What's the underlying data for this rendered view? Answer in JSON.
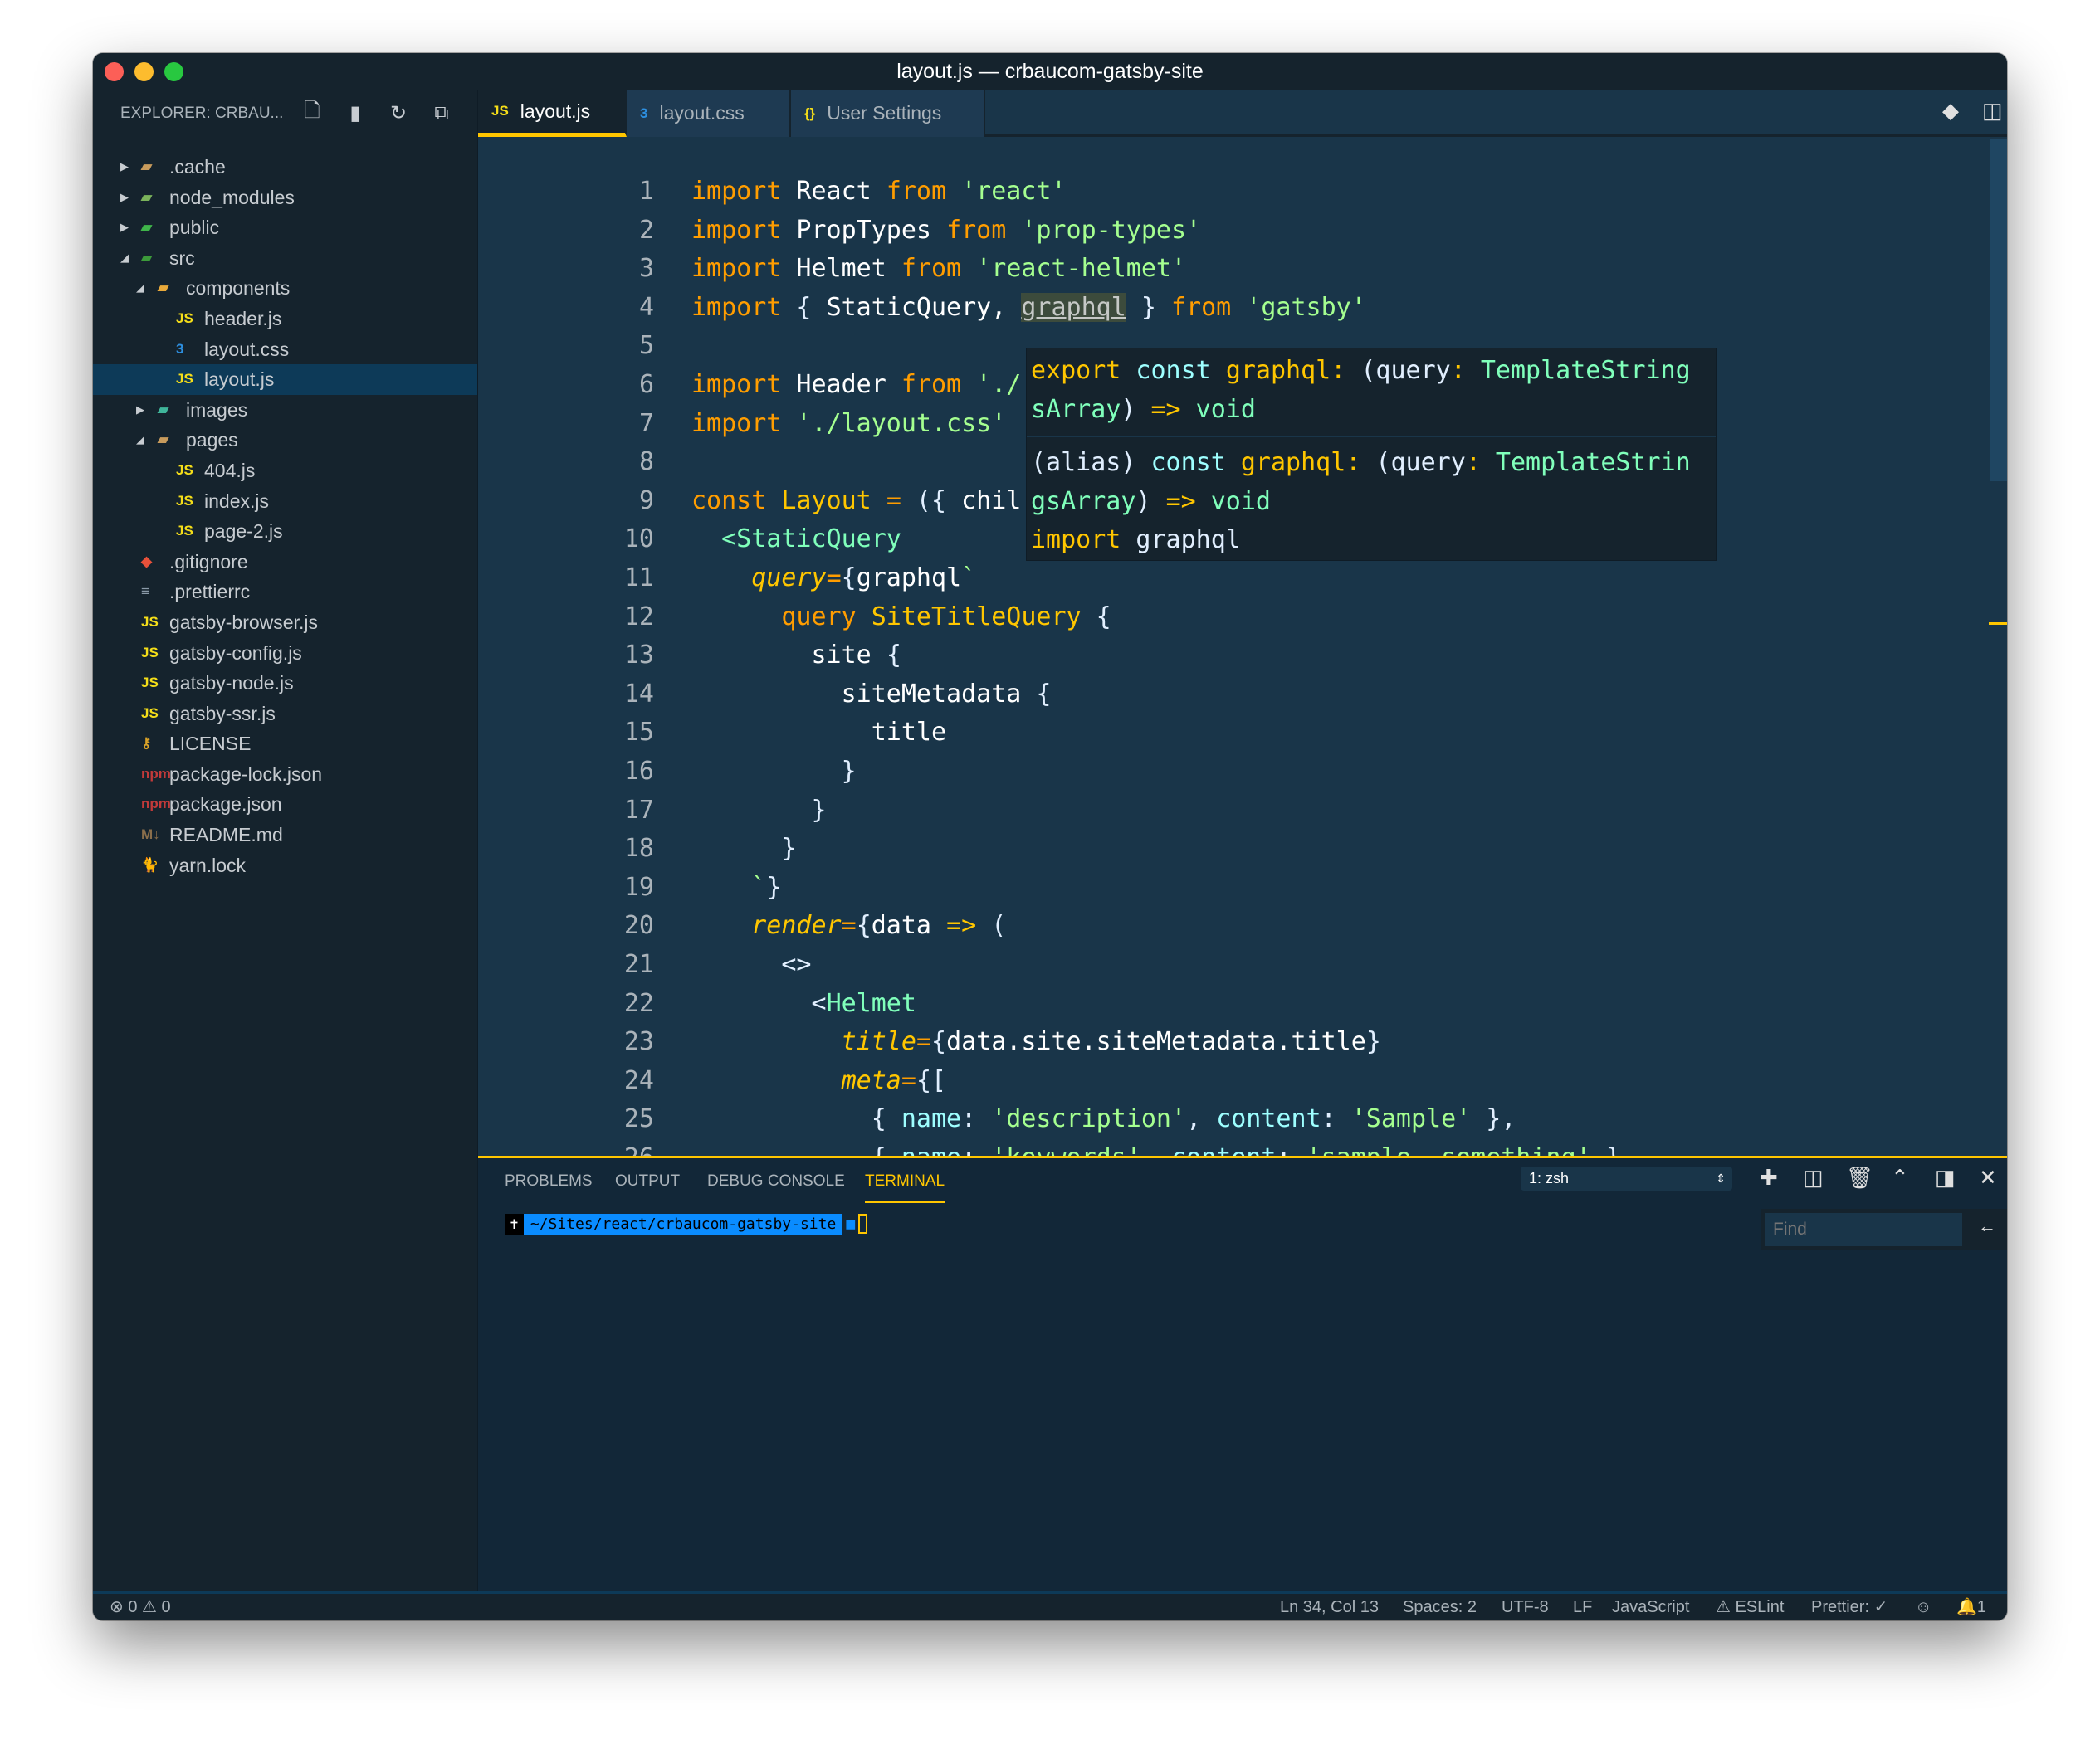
{
  "window": {
    "title": "layout.js — crbaucom-gatsby-site"
  },
  "colors": {
    "accent": "#ffc600",
    "editor_bg": "#193549",
    "sidebar_bg": "#15232d",
    "keyword": "#ff9d00",
    "string": "#a5ff90"
  },
  "sidebar": {
    "title": "EXPLORER: CRBAU...",
    "actions": [
      "new-file-icon",
      "new-folder-icon",
      "refresh-icon",
      "collapse-all-icon"
    ],
    "items": [
      {
        "label": ".cache",
        "level": 0,
        "kind": "folder",
        "expanded": false,
        "icon": "folder-icon",
        "icon_text": "▰",
        "color": "#c89b5c"
      },
      {
        "label": "node_modules",
        "level": 0,
        "kind": "folder",
        "expanded": false,
        "icon": "node-folder-icon",
        "icon_text": "▰",
        "color": "#7bb35b"
      },
      {
        "label": "public",
        "level": 0,
        "kind": "folder",
        "expanded": false,
        "icon": "public-folder-icon",
        "icon_text": "▰",
        "color": "#3fb54a"
      },
      {
        "label": "src",
        "level": 0,
        "kind": "folder",
        "expanded": true,
        "icon": "src-folder-icon",
        "icon_text": "▰",
        "color": "#3c9a3a"
      },
      {
        "label": "components",
        "level": 1,
        "kind": "folder",
        "expanded": true,
        "icon": "components-folder-icon",
        "icon_text": "▰",
        "color": "#e8a93a"
      },
      {
        "label": "header.js",
        "level": 2,
        "kind": "file",
        "icon": "javascript-file-icon",
        "icon_text": "JS",
        "color": "#f5de19"
      },
      {
        "label": "layout.css",
        "level": 2,
        "kind": "file",
        "icon": "css-file-icon",
        "icon_text": "3",
        "color": "#2d8fe0"
      },
      {
        "label": "layout.js",
        "level": 2,
        "kind": "file",
        "icon": "javascript-file-icon",
        "icon_text": "JS",
        "color": "#f5de19",
        "selected": true
      },
      {
        "label": "images",
        "level": 1,
        "kind": "folder",
        "expanded": false,
        "icon": "images-folder-icon",
        "icon_text": "▰",
        "color": "#3fb59a"
      },
      {
        "label": "pages",
        "level": 1,
        "kind": "folder",
        "expanded": true,
        "icon": "folder-icon",
        "icon_text": "▰",
        "color": "#c89b5c"
      },
      {
        "label": "404.js",
        "level": 2,
        "kind": "file",
        "icon": "javascript-file-icon",
        "icon_text": "JS",
        "color": "#f5de19"
      },
      {
        "label": "index.js",
        "level": 2,
        "kind": "file",
        "icon": "javascript-file-icon",
        "icon_text": "JS",
        "color": "#f5de19"
      },
      {
        "label": "page-2.js",
        "level": 2,
        "kind": "file",
        "icon": "javascript-file-icon",
        "icon_text": "JS",
        "color": "#f5de19"
      },
      {
        "label": ".gitignore",
        "level": 0,
        "kind": "file",
        "icon": "git-icon",
        "icon_text": "◆",
        "color": "#e8513a"
      },
      {
        "label": ".prettierrc",
        "level": 0,
        "kind": "file",
        "icon": "prettier-icon",
        "icon_text": "≡",
        "color": "#8a9aa8"
      },
      {
        "label": "gatsby-browser.js",
        "level": 0,
        "kind": "file",
        "icon": "javascript-file-icon",
        "icon_text": "JS",
        "color": "#f5de19"
      },
      {
        "label": "gatsby-config.js",
        "level": 0,
        "kind": "file",
        "icon": "javascript-file-icon",
        "icon_text": "JS",
        "color": "#f5de19"
      },
      {
        "label": "gatsby-node.js",
        "level": 0,
        "kind": "file",
        "icon": "javascript-file-icon",
        "icon_text": "JS",
        "color": "#f5de19"
      },
      {
        "label": "gatsby-ssr.js",
        "level": 0,
        "kind": "file",
        "icon": "javascript-file-icon",
        "icon_text": "JS",
        "color": "#f5de19"
      },
      {
        "label": "LICENSE",
        "level": 0,
        "kind": "file",
        "icon": "license-key-icon",
        "icon_text": "⚷",
        "color": "#d9a227"
      },
      {
        "label": "package-lock.json",
        "level": 0,
        "kind": "file",
        "icon": "npm-icon",
        "icon_text": "npm",
        "color": "#c23a3a"
      },
      {
        "label": "package.json",
        "level": 0,
        "kind": "file",
        "icon": "npm-icon",
        "icon_text": "npm",
        "color": "#c23a3a"
      },
      {
        "label": "README.md",
        "level": 0,
        "kind": "file",
        "icon": "markdown-icon",
        "icon_text": "M↓",
        "color": "#8a6e4b"
      },
      {
        "label": "yarn.lock",
        "level": 0,
        "kind": "file",
        "icon": "yarn-icon",
        "icon_text": "🐈",
        "color": "#2c8ebb"
      }
    ]
  },
  "tabs": [
    {
      "label": "layout.js",
      "icon": "javascript-file-icon",
      "icon_text": "JS",
      "color": "#f5de19",
      "active": true
    },
    {
      "label": "layout.css",
      "icon": "css-file-icon",
      "icon_text": "3",
      "color": "#2d8fe0"
    },
    {
      "label": "User Settings",
      "icon": "json-braces-icon",
      "icon_text": "{}",
      "color": "#f5de19"
    }
  ],
  "tab_actions": [
    "git-compare-icon",
    "split-editor-icon",
    "more-actions-icon"
  ],
  "editor": {
    "lines": [
      [
        [
          "kw",
          "import"
        ],
        [
          "id",
          " React "
        ],
        [
          "kw",
          "from"
        ],
        [
          "str",
          " 'react'"
        ]
      ],
      [
        [
          "kw",
          "import"
        ],
        [
          "id",
          " PropTypes "
        ],
        [
          "kw",
          "from"
        ],
        [
          "str",
          " 'prop-types'"
        ]
      ],
      [
        [
          "kw",
          "import"
        ],
        [
          "id",
          " Helmet "
        ],
        [
          "kw",
          "from"
        ],
        [
          "str",
          " 'react-helmet'"
        ]
      ],
      [
        [
          "kw",
          "import"
        ],
        [
          "pn",
          " { "
        ],
        [
          "id",
          "StaticQuery, "
        ],
        [
          "hl",
          "graphql"
        ],
        [
          "pn",
          " } "
        ],
        [
          "kw",
          "from"
        ],
        [
          "str",
          " 'gatsby'"
        ]
      ],
      [],
      [
        [
          "kw",
          "import"
        ],
        [
          "id",
          " Header "
        ],
        [
          "kw",
          "from"
        ],
        [
          "str",
          " './"
        ]
      ],
      [
        [
          "kw",
          "import"
        ],
        [
          "str",
          " './layout.css'"
        ]
      ],
      [],
      [
        [
          "kw",
          "const"
        ],
        [
          "yl",
          " Layout "
        ],
        [
          "op",
          "="
        ],
        [
          "pn",
          " ({ "
        ],
        [
          "id",
          "chil"
        ]
      ],
      [
        [
          "id",
          "  "
        ],
        [
          "tag",
          "<StaticQuery"
        ]
      ],
      [
        [
          "id",
          "    "
        ],
        [
          "at",
          "query"
        ],
        [
          "op",
          "="
        ],
        [
          "pn",
          "{"
        ],
        [
          "id",
          "graphql"
        ],
        [
          "str",
          "`"
        ]
      ],
      [
        [
          "id",
          "      "
        ],
        [
          "kw",
          "query"
        ],
        [
          "yl",
          " SiteTitleQuery "
        ],
        [
          "pn",
          "{"
        ]
      ],
      [
        [
          "id",
          "        site "
        ],
        [
          "pn",
          "{"
        ]
      ],
      [
        [
          "id",
          "          siteMetadata "
        ],
        [
          "pn",
          "{"
        ]
      ],
      [
        [
          "id",
          "            title"
        ]
      ],
      [
        [
          "pn",
          "          }"
        ]
      ],
      [
        [
          "pn",
          "        }"
        ]
      ],
      [
        [
          "pn",
          "      }"
        ]
      ],
      [
        [
          "id",
          "    "
        ],
        [
          "str",
          "`"
        ],
        [
          "pn",
          "}"
        ]
      ],
      [
        [
          "id",
          "    "
        ],
        [
          "at",
          "render"
        ],
        [
          "op",
          "="
        ],
        [
          "pn",
          "{"
        ],
        [
          "id",
          "data "
        ],
        [
          "yl",
          "=>"
        ],
        [
          "pn",
          " ("
        ]
      ],
      [
        [
          "pn",
          "      <>"
        ]
      ],
      [
        [
          "pn",
          "        <"
        ],
        [
          "tag",
          "Helmet"
        ]
      ],
      [
        [
          "id",
          "          "
        ],
        [
          "at",
          "title"
        ],
        [
          "op",
          "="
        ],
        [
          "pn",
          "{"
        ],
        [
          "id",
          "data.site.siteMetadata.title"
        ],
        [
          "pn",
          "}"
        ]
      ],
      [
        [
          "id",
          "          "
        ],
        [
          "at",
          "meta"
        ],
        [
          "op",
          "="
        ],
        [
          "pn",
          "{["
        ]
      ],
      [
        [
          "pn",
          "            { "
        ],
        [
          "cy",
          "name"
        ],
        [
          "pn",
          ": "
        ],
        [
          "str",
          "'description'"
        ],
        [
          "pn",
          ", "
        ],
        [
          "cy",
          "content"
        ],
        [
          "pn",
          ": "
        ],
        [
          "str",
          "'Sample'"
        ],
        [
          "pn",
          " },"
        ]
      ],
      [
        [
          "pn",
          "            { "
        ],
        [
          "cy",
          "name"
        ],
        [
          "pn",
          ": "
        ],
        [
          "str",
          "'keywords'"
        ],
        [
          "pn",
          ", "
        ],
        [
          "cy",
          "content"
        ],
        [
          "pn",
          ": "
        ],
        [
          "str",
          "'sample, something'"
        ],
        [
          "pn",
          " },"
        ]
      ]
    ]
  },
  "hover": {
    "rows": [
      [
        [
          "yl",
          "export"
        ],
        [
          "cy",
          " const "
        ],
        [
          "yl",
          "graphql"
        ],
        [
          "yl",
          ":"
        ],
        [
          "pn",
          " (query"
        ],
        [
          "yl",
          ":"
        ],
        [
          "tag",
          " TemplateString"
        ]
      ],
      [
        [
          "tag",
          "sArray"
        ],
        [
          "pn",
          ") "
        ],
        [
          "yl",
          "=>"
        ],
        [
          "tag",
          " void"
        ]
      ],
      [
        [
          "pn",
          "(alias)"
        ],
        [
          "cy",
          " const "
        ],
        [
          "yl",
          "graphql"
        ],
        [
          "yl",
          ":"
        ],
        [
          "pn",
          " (query"
        ],
        [
          "yl",
          ":"
        ],
        [
          "tag",
          " TemplateStrin"
        ]
      ],
      [
        [
          "tag",
          "gsArray"
        ],
        [
          "pn",
          ") "
        ],
        [
          "yl",
          "=>"
        ],
        [
          "tag",
          " void"
        ]
      ],
      [
        [
          "yl",
          "import"
        ],
        [
          "pn",
          " graphql"
        ]
      ]
    ]
  },
  "panel": {
    "tabs": [
      "PROBLEMS",
      "OUTPUT",
      "DEBUG CONSOLE",
      "TERMINAL"
    ],
    "active_tab": "TERMINAL",
    "terminal_select": "1: zsh",
    "actions": [
      "add-terminal-icon",
      "split-terminal-icon",
      "trash-icon",
      "maximize-chevron-icon",
      "toggle-panel-icon",
      "close-icon"
    ],
    "prompt_path": "~/Sites/react/crbaucom-gatsby-site",
    "find_placeholder": "Find"
  },
  "status": {
    "errors": "0",
    "warnings": "0",
    "position": "Ln 34, Col 13",
    "spaces": "Spaces: 2",
    "encoding": "UTF-8",
    "eol": "LF",
    "language": "JavaScript",
    "eslint": "ESLint",
    "prettier": "Prettier: ✓",
    "notifications": "1"
  }
}
